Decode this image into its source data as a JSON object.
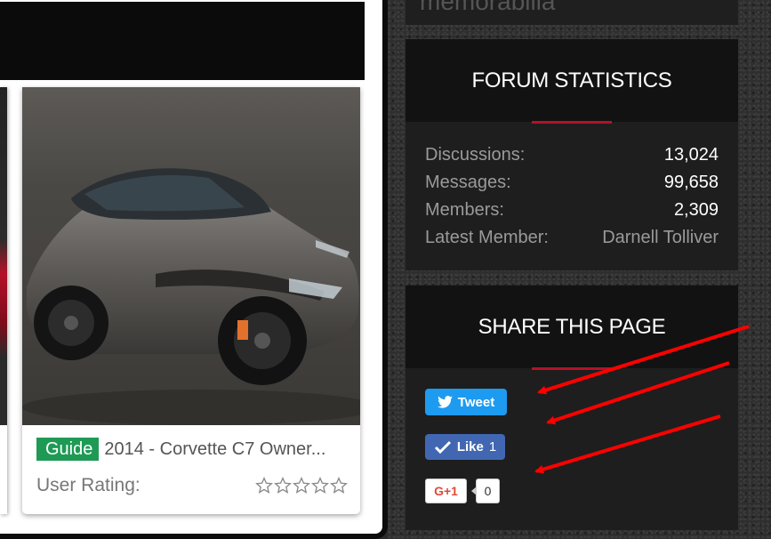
{
  "sidebar": {
    "previous_block_title": "memorabilia",
    "forum_statistics": {
      "title": "FORUM STATISTICS",
      "rows": [
        {
          "label": "Discussions:",
          "value": "13,024"
        },
        {
          "label": "Messages:",
          "value": "99,658"
        },
        {
          "label": "Members:",
          "value": "2,309"
        },
        {
          "label": "Latest Member:",
          "value": "Darnell Tolliver"
        }
      ]
    },
    "share": {
      "title": "SHARE THIS PAGE",
      "tweet_label": "Tweet",
      "like_label": "Like",
      "like_count": "1",
      "gplus_label": "G+1",
      "gplus_count": "0"
    }
  },
  "card": {
    "badge": "Guide",
    "title": "2014 - Corvette C7 Owner...",
    "rating_label": "User Rating:",
    "rating_stars": 0,
    "rating_max": 5
  },
  "colors": {
    "accent_red": "#b3122a",
    "guide_green": "#1f9a55",
    "twitter_blue": "#1d9bf0",
    "facebook_blue": "#4267b2",
    "gplus_red": "#dd4b39",
    "annotation_arrow": "#ff0000"
  },
  "icons": [
    "twitter-bird-icon",
    "facebook-like-check-icon",
    "star-outline-icon"
  ]
}
